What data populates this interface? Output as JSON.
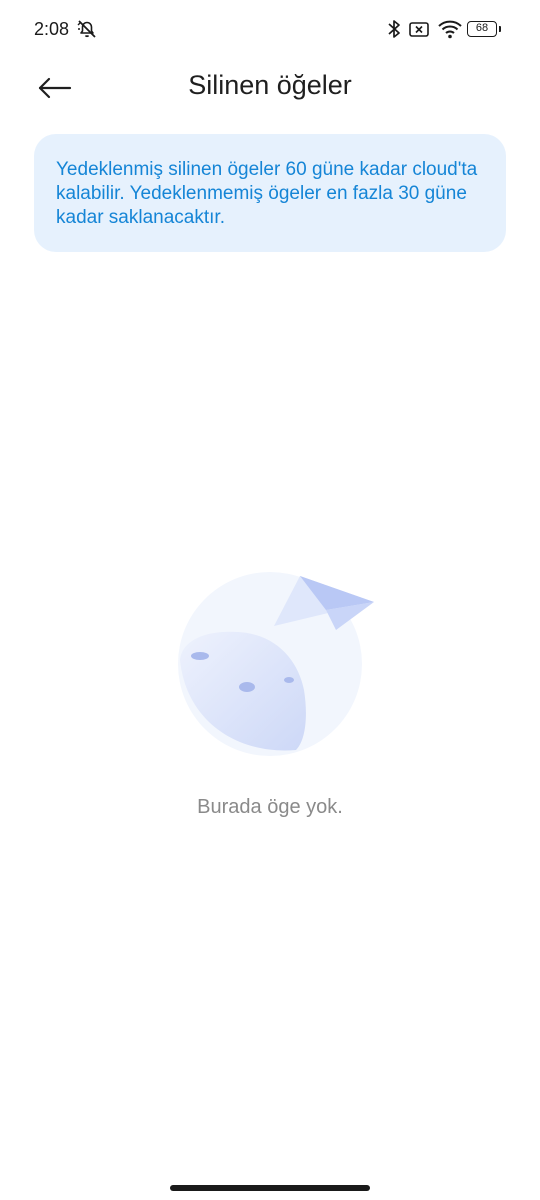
{
  "status_bar": {
    "time": "2:08",
    "battery": "68",
    "icons": [
      "mute-icon",
      "bluetooth-icon",
      "no-sim-icon",
      "wifi-icon",
      "battery-icon"
    ]
  },
  "header": {
    "back_icon": "arrow-left-icon",
    "title": "Silinen öğeler"
  },
  "info_banner": {
    "text": "Yedeklenmiş silinen ögeler 60 güne kadar cloud'ta kalabilir. Yedeklenmemiş ögeler en fazla 30 güne kadar saklanacaktır."
  },
  "empty_state": {
    "illustration": "moon-paper-plane-illustration",
    "message": "Burada öge yok."
  },
  "colors": {
    "accent_text": "#1585d6",
    "banner_bg": "#e6f1fd",
    "muted_text": "#8a8a8a"
  }
}
